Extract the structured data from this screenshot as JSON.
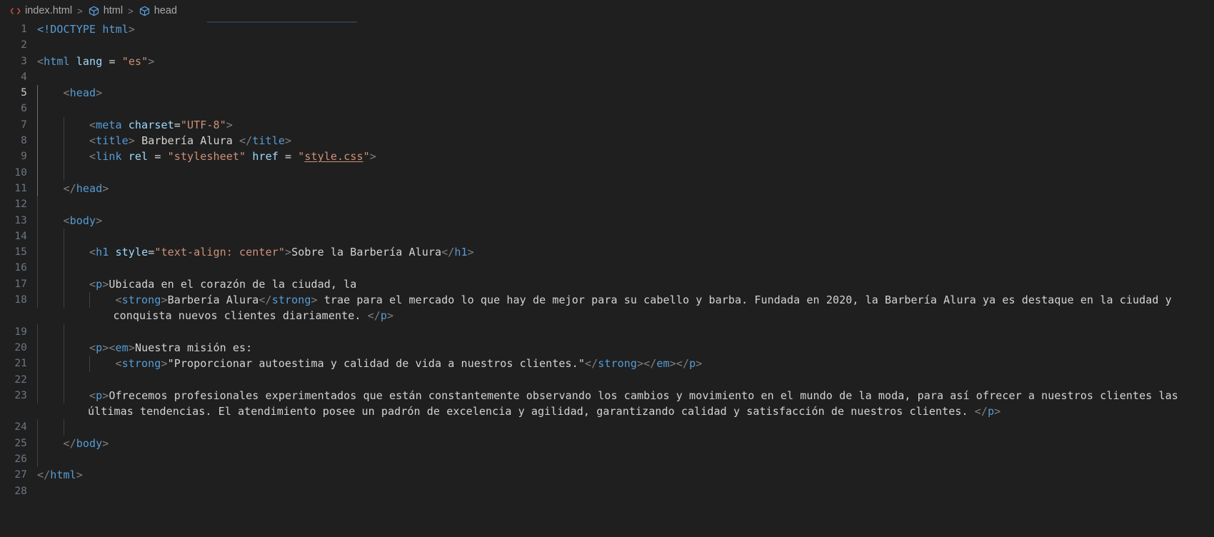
{
  "breadcrumb": {
    "file_icon": "html5-file-icon",
    "file": "index.html",
    "separator": ">",
    "items": [
      {
        "icon": "symbol-field-icon",
        "label": "html"
      },
      {
        "icon": "symbol-field-icon",
        "label": "head"
      }
    ]
  },
  "editor": {
    "language": "html",
    "total_lines": 28,
    "lines": [
      {
        "n": "1",
        "segments": [
          {
            "c": "doctype",
            "t": "<!DOCTYPE "
          },
          {
            "c": "tag",
            "t": "html"
          },
          {
            "c": "punct",
            "t": ">"
          }
        ]
      },
      {
        "n": "2",
        "segments": []
      },
      {
        "n": "3",
        "segments": [
          {
            "c": "punct",
            "t": "<"
          },
          {
            "c": "tag",
            "t": "html "
          },
          {
            "c": "attr",
            "t": "lang"
          },
          {
            "c": "eq",
            "t": " = "
          },
          {
            "c": "str",
            "t": "\"es\""
          },
          {
            "c": "punct",
            "t": ">"
          }
        ]
      },
      {
        "n": "4",
        "segments": []
      },
      {
        "n": "5",
        "indent": 1,
        "segments": [
          {
            "c": "punct",
            "t": "<"
          },
          {
            "c": "tag",
            "t": "head"
          },
          {
            "c": "punct",
            "t": ">"
          }
        ]
      },
      {
        "n": "6",
        "indent": 1,
        "segments": []
      },
      {
        "n": "7",
        "indent": 2,
        "segments": [
          {
            "c": "punct",
            "t": "<"
          },
          {
            "c": "tag",
            "t": "meta "
          },
          {
            "c": "attr",
            "t": "charset"
          },
          {
            "c": "eq",
            "t": "="
          },
          {
            "c": "str",
            "t": "\"UTF-8\""
          },
          {
            "c": "punct",
            "t": ">"
          }
        ]
      },
      {
        "n": "8",
        "indent": 2,
        "segments": [
          {
            "c": "punct",
            "t": "<"
          },
          {
            "c": "tag",
            "t": "title"
          },
          {
            "c": "punct",
            "t": ">"
          },
          {
            "c": "text",
            "t": " Barbería Alura "
          },
          {
            "c": "punct",
            "t": "</"
          },
          {
            "c": "tag",
            "t": "title"
          },
          {
            "c": "punct",
            "t": ">"
          }
        ]
      },
      {
        "n": "9",
        "indent": 2,
        "segments": [
          {
            "c": "punct",
            "t": "<"
          },
          {
            "c": "tag",
            "t": "link "
          },
          {
            "c": "attr",
            "t": "rel"
          },
          {
            "c": "eq",
            "t": " = "
          },
          {
            "c": "str",
            "t": "\"stylesheet\""
          },
          {
            "c": "text",
            "t": " "
          },
          {
            "c": "attr",
            "t": "href"
          },
          {
            "c": "eq",
            "t": " = "
          },
          {
            "c": "str",
            "t": "\""
          },
          {
            "c": "link",
            "t": "style.css"
          },
          {
            "c": "str",
            "t": "\""
          },
          {
            "c": "punct",
            "t": ">"
          }
        ]
      },
      {
        "n": "10",
        "indent": 2,
        "segments": []
      },
      {
        "n": "11",
        "indent": 1,
        "segments": [
          {
            "c": "punct",
            "t": "</"
          },
          {
            "c": "tag",
            "t": "head"
          },
          {
            "c": "punct",
            "t": ">"
          }
        ]
      },
      {
        "n": "12",
        "indent": 1,
        "segments": []
      },
      {
        "n": "13",
        "indent": 1,
        "segments": [
          {
            "c": "punct",
            "t": "<"
          },
          {
            "c": "tag",
            "t": "body"
          },
          {
            "c": "punct",
            "t": ">"
          }
        ]
      },
      {
        "n": "14",
        "indent": 2,
        "segments": []
      },
      {
        "n": "15",
        "indent": 2,
        "segments": [
          {
            "c": "punct",
            "t": "<"
          },
          {
            "c": "tag",
            "t": "h1 "
          },
          {
            "c": "attr",
            "t": "style"
          },
          {
            "c": "eq",
            "t": "="
          },
          {
            "c": "str",
            "t": "\"text-align: center\""
          },
          {
            "c": "punct",
            "t": ">"
          },
          {
            "c": "text",
            "t": "Sobre la Barbería Alura"
          },
          {
            "c": "punct",
            "t": "</"
          },
          {
            "c": "tag",
            "t": "h1"
          },
          {
            "c": "punct",
            "t": ">"
          }
        ]
      },
      {
        "n": "16",
        "indent": 2,
        "segments": []
      },
      {
        "n": "17",
        "indent": 2,
        "segments": [
          {
            "c": "punct",
            "t": "<"
          },
          {
            "c": "tag",
            "t": "p"
          },
          {
            "c": "punct",
            "t": ">"
          },
          {
            "c": "text",
            "t": "Ubicada en el corazón de la ciudad, la"
          }
        ]
      },
      {
        "n": "18",
        "indent": 3,
        "wrap": true,
        "segments": [
          {
            "c": "punct",
            "t": "<"
          },
          {
            "c": "tag",
            "t": "strong"
          },
          {
            "c": "punct",
            "t": ">"
          },
          {
            "c": "text",
            "t": "Barbería Alura"
          },
          {
            "c": "punct",
            "t": "</"
          },
          {
            "c": "tag",
            "t": "strong"
          },
          {
            "c": "punct",
            "t": ">"
          },
          {
            "c": "text",
            "t": " trae para el mercado lo que hay de mejor para su cabello y barba. Fundada en 2020, la Barbería Alura ya es destaque en la ciudad y conquista nuevos clientes diariamente. "
          },
          {
            "c": "punct",
            "t": "</"
          },
          {
            "c": "tag",
            "t": "p"
          },
          {
            "c": "punct",
            "t": ">"
          }
        ]
      },
      {
        "n": "19",
        "indent": 2,
        "segments": []
      },
      {
        "n": "20",
        "indent": 2,
        "segments": [
          {
            "c": "punct",
            "t": "<"
          },
          {
            "c": "tag",
            "t": "p"
          },
          {
            "c": "punct",
            "t": "><"
          },
          {
            "c": "tag",
            "t": "em"
          },
          {
            "c": "punct",
            "t": ">"
          },
          {
            "c": "text",
            "t": "Nuestra misión es:"
          }
        ]
      },
      {
        "n": "21",
        "indent": 3,
        "segments": [
          {
            "c": "punct",
            "t": "<"
          },
          {
            "c": "tag",
            "t": "strong"
          },
          {
            "c": "punct",
            "t": ">"
          },
          {
            "c": "text",
            "t": "\"Proporcionar autoestima y calidad de vida a nuestros clientes.\""
          },
          {
            "c": "punct",
            "t": "</"
          },
          {
            "c": "tag",
            "t": "strong"
          },
          {
            "c": "punct",
            "t": "></"
          },
          {
            "c": "tag",
            "t": "em"
          },
          {
            "c": "punct",
            "t": "></"
          },
          {
            "c": "tag",
            "t": "p"
          },
          {
            "c": "punct",
            "t": ">"
          }
        ]
      },
      {
        "n": "22",
        "indent": 2,
        "segments": []
      },
      {
        "n": "23",
        "indent": 2,
        "wrap": true,
        "segments": [
          {
            "c": "punct",
            "t": "<"
          },
          {
            "c": "tag",
            "t": "p"
          },
          {
            "c": "punct",
            "t": ">"
          },
          {
            "c": "text",
            "t": "Ofrecemos profesionales experimentados que están constantemente observando los cambios y movimiento en el mundo de la moda, para así ofrecer a nuestros clientes las últimas tendencias. El atendimiento posee un padrón de excelencia y agilidad, garantizando calidad y satisfacción de nuestros clientes. "
          },
          {
            "c": "punct",
            "t": "</"
          },
          {
            "c": "tag",
            "t": "p"
          },
          {
            "c": "punct",
            "t": ">"
          }
        ]
      },
      {
        "n": "24",
        "indent": 2,
        "segments": []
      },
      {
        "n": "25",
        "indent": 1,
        "segments": [
          {
            "c": "punct",
            "t": "</"
          },
          {
            "c": "tag",
            "t": "body"
          },
          {
            "c": "punct",
            "t": ">"
          }
        ]
      },
      {
        "n": "26",
        "indent": 1,
        "segments": []
      },
      {
        "n": "27",
        "segments": [
          {
            "c": "punct",
            "t": "</"
          },
          {
            "c": "tag",
            "t": "html"
          },
          {
            "c": "punct",
            "t": ">"
          }
        ]
      },
      {
        "n": "28",
        "segments": []
      }
    ]
  },
  "theme": {
    "background": "#1f1f1f",
    "foreground": "#d4d4d4",
    "tag": "#569cd6",
    "attribute": "#9cdcfe",
    "string": "#ce9178",
    "punctuation": "#808080",
    "line_number": "#6e7681",
    "line_number_active": "#cccccc",
    "indent_guide": "#404040",
    "indent_guide_active": "#707070"
  }
}
